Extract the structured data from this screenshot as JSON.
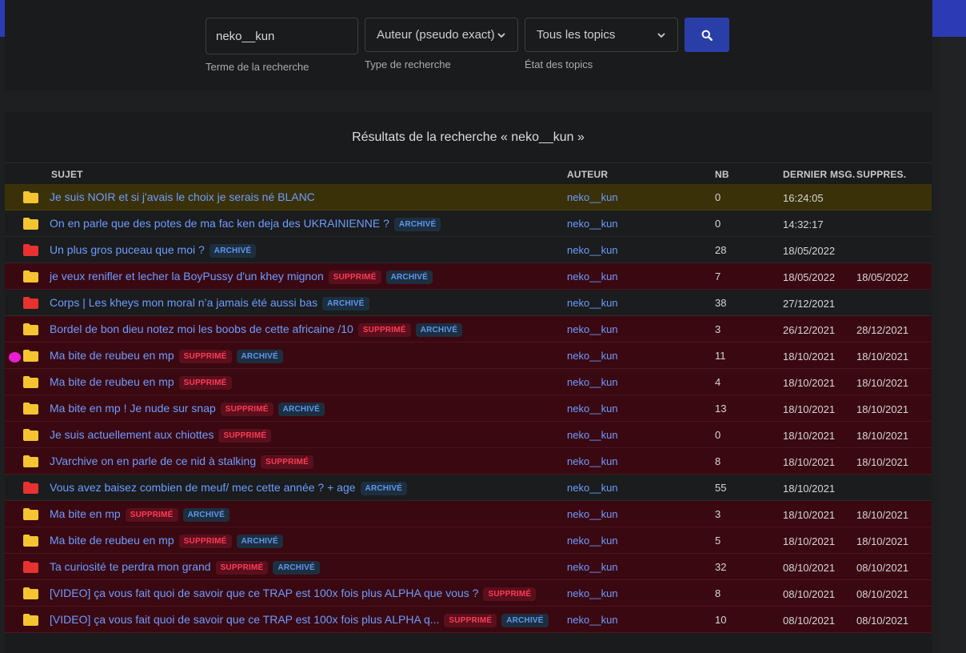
{
  "colors": {
    "accent": "#2a3ea8",
    "link": "#6e9cff",
    "suppressed_row": "#3a0811",
    "pinned_row": "#3a3108",
    "folder_yellow": "#f5c431",
    "folder_red": "#e8322f"
  },
  "search": {
    "term_value": "neko__kun",
    "term_hint": "Terme de la recherche",
    "type_value": "Auteur (pseudo exact)",
    "type_hint": "Type de recherche",
    "state_value": "Tous les topics",
    "state_hint": "État des topics",
    "button_icon": "search-icon"
  },
  "results": {
    "title": "Résultats de la recherche « neko__kun »",
    "columns": {
      "subject": "SUJET",
      "author": "AUTEUR",
      "nb": "NB",
      "last": "DERNIER MSG.",
      "deleted": "SUPPRES."
    },
    "rows": [
      {
        "subject": "Je suis NOIR et si j'avais le choix je serais né BLANC",
        "supprime": false,
        "archive": false,
        "author": "neko__kun",
        "nb": "0",
        "last": "16:24:05",
        "deleted": "",
        "folder": "yellow",
        "style": "pinned"
      },
      {
        "subject": "On en parle que des potes de ma fac ken deja des UKRAINIENNE ?",
        "supprime": false,
        "archive": true,
        "author": "neko__kun",
        "nb": "0",
        "last": "14:32:17",
        "deleted": "",
        "folder": "yellow",
        "style": "normal"
      },
      {
        "subject": "Un plus gros puceau que moi ?",
        "supprime": false,
        "archive": true,
        "author": "neko__kun",
        "nb": "28",
        "last": "18/05/2022",
        "deleted": "",
        "folder": "red",
        "style": "normal"
      },
      {
        "subject": "je veux renifler et lecher la BoyPussy d'un khey mignon",
        "supprime": true,
        "archive": true,
        "author": "neko__kun",
        "nb": "7",
        "last": "18/05/2022",
        "deleted": "18/05/2022",
        "folder": "yellow",
        "style": "suppr"
      },
      {
        "subject": "Corps | Les kheys mon moral n’a jamais été aussi bas",
        "supprime": false,
        "archive": true,
        "author": "neko__kun",
        "nb": "38",
        "last": "27/12/2021",
        "deleted": "",
        "folder": "red",
        "style": "normal"
      },
      {
        "subject": "Bordel de bon dieu notez moi les boobs de cette africaine /10",
        "supprime": true,
        "archive": true,
        "author": "neko__kun",
        "nb": "3",
        "last": "26/12/2021",
        "deleted": "28/12/2021",
        "folder": "yellow",
        "style": "suppr"
      },
      {
        "subject": "Ma bite de reubeu en mp",
        "supprime": true,
        "archive": true,
        "author": "neko__kun",
        "nb": "11",
        "last": "18/10/2021",
        "deleted": "18/10/2021",
        "folder": "yellow",
        "style": "suppr"
      },
      {
        "subject": "Ma bite de reubeu en mp",
        "supprime": true,
        "archive": false,
        "author": "neko__kun",
        "nb": "4",
        "last": "18/10/2021",
        "deleted": "18/10/2021",
        "folder": "yellow",
        "style": "suppr"
      },
      {
        "subject": "Ma bite en mp ! Je nude sur snap",
        "supprime": true,
        "archive": true,
        "author": "neko__kun",
        "nb": "13",
        "last": "18/10/2021",
        "deleted": "18/10/2021",
        "folder": "yellow",
        "style": "suppr"
      },
      {
        "subject": "Je suis actuellement aux chiottes",
        "supprime": true,
        "archive": false,
        "author": "neko__kun",
        "nb": "0",
        "last": "18/10/2021",
        "deleted": "18/10/2021",
        "folder": "yellow",
        "style": "suppr"
      },
      {
        "subject": "JVarchive on en parle de ce nid à stalking",
        "supprime": true,
        "archive": false,
        "author": "neko__kun",
        "nb": "8",
        "last": "18/10/2021",
        "deleted": "18/10/2021",
        "folder": "yellow",
        "style": "suppr"
      },
      {
        "subject": "Vous avez baisez combien de meuf/ mec cette année ? + age",
        "supprime": false,
        "archive": true,
        "author": "neko__kun",
        "nb": "55",
        "last": "18/10/2021",
        "deleted": "",
        "folder": "red",
        "style": "normal"
      },
      {
        "subject": "Ma bite en mp",
        "supprime": true,
        "archive": true,
        "author": "neko__kun",
        "nb": "3",
        "last": "18/10/2021",
        "deleted": "18/10/2021",
        "folder": "yellow",
        "style": "suppr"
      },
      {
        "subject": "Ma bite de reubeu en mp",
        "supprime": true,
        "archive": true,
        "author": "neko__kun",
        "nb": "5",
        "last": "18/10/2021",
        "deleted": "18/10/2021",
        "folder": "yellow",
        "style": "suppr"
      },
      {
        "subject": "Ta curiosité te perdra mon grand",
        "supprime": true,
        "archive": true,
        "author": "neko__kun",
        "nb": "32",
        "last": "08/10/2021",
        "deleted": "08/10/2021",
        "folder": "red",
        "style": "suppr"
      },
      {
        "subject": "[VIDEO] ça vous fait quoi de savoir que ce TRAP est 100x fois plus ALPHA que vous ?",
        "supprime": true,
        "archive": false,
        "author": "neko__kun",
        "nb": "8",
        "last": "08/10/2021",
        "deleted": "08/10/2021",
        "folder": "yellow",
        "style": "suppr"
      },
      {
        "subject": "[VIDEO] ça vous fait quoi de savoir que ce TRAP est 100x fois plus ALPHA q...",
        "supprime": true,
        "archive": true,
        "author": "neko__kun",
        "nb": "10",
        "last": "08/10/2021",
        "deleted": "08/10/2021",
        "folder": "yellow",
        "style": "suppr"
      }
    ],
    "badges": {
      "supprime": "SUPPRIMÉ",
      "archive": "ARCHIVÉ"
    }
  }
}
